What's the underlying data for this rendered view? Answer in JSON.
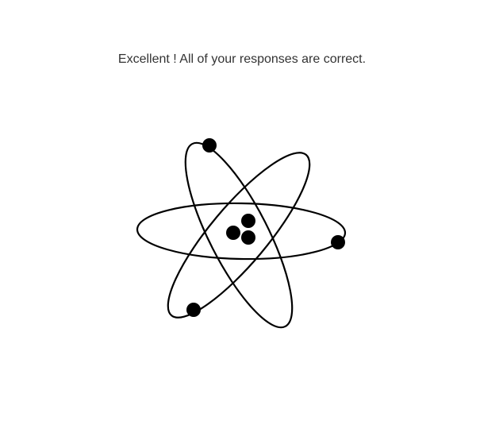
{
  "result": {
    "message": "Excellent ! All of your responses are correct."
  },
  "graphic": {
    "icon": "atom-icon",
    "stroke_color": "#000000"
  }
}
